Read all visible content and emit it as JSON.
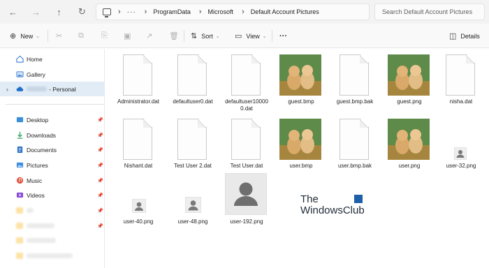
{
  "address": {
    "crumbs": [
      "ProgramData",
      "Microsoft",
      "Default Account Pictures"
    ],
    "overflow": "···",
    "search_placeholder": "Search Default Account Pictures"
  },
  "commands": {
    "new": "New",
    "sort": "Sort",
    "view": "View",
    "more": "···",
    "details": "Details"
  },
  "sidebar": {
    "top_items": [
      {
        "label": "Home",
        "icon": "home-icon"
      },
      {
        "label": "Gallery",
        "icon": "gallery-icon"
      },
      {
        "label": "- Personal",
        "icon": "onedrive-cloud-icon"
      }
    ],
    "quick_access": [
      {
        "label": "Desktop",
        "icon": "desktop-folder-icon"
      },
      {
        "label": "Downloads",
        "icon": "downloads-folder-icon"
      },
      {
        "label": "Documents",
        "icon": "documents-folder-icon"
      },
      {
        "label": "Pictures",
        "icon": "pictures-folder-icon"
      },
      {
        "label": "Music",
        "icon": "music-folder-icon"
      },
      {
        "label": "Videos",
        "icon": "videos-folder-icon"
      }
    ]
  },
  "files": [
    {
      "name": "Administrator.dat",
      "kind": "doc"
    },
    {
      "name": "defaultuser0.dat",
      "kind": "doc"
    },
    {
      "name": "defaultuser10000",
      "name2": "0.dat",
      "kind": "doc"
    },
    {
      "name": "guest.bmp",
      "kind": "photo"
    },
    {
      "name": "guest.bmp.bak",
      "kind": "doc"
    },
    {
      "name": "guest.png",
      "kind": "photo"
    },
    {
      "name": "nisha.dat",
      "kind": "doc"
    },
    {
      "name": "Nishant.dat",
      "kind": "doc"
    },
    {
      "name": "Test User 2.dat",
      "kind": "doc"
    },
    {
      "name": "Test User.dat",
      "kind": "doc"
    },
    {
      "name": "user.bmp",
      "kind": "photo"
    },
    {
      "name": "user.bmp.bak",
      "kind": "doc"
    },
    {
      "name": "user.png",
      "kind": "photo"
    },
    {
      "name": "user-32.png",
      "kind": "avatar-small"
    },
    {
      "name": "user-40.png",
      "kind": "avatar-small"
    },
    {
      "name": "user-48.png",
      "kind": "avatar-small"
    },
    {
      "name": "user-192.png",
      "kind": "avatar-large"
    }
  ],
  "watermark": {
    "line1": "The",
    "line2": "WindowsClub"
  },
  "colors": {
    "selection": "#e1ecf7",
    "accent": "#1d5fa8",
    "chrome": "#f3f3f3"
  }
}
